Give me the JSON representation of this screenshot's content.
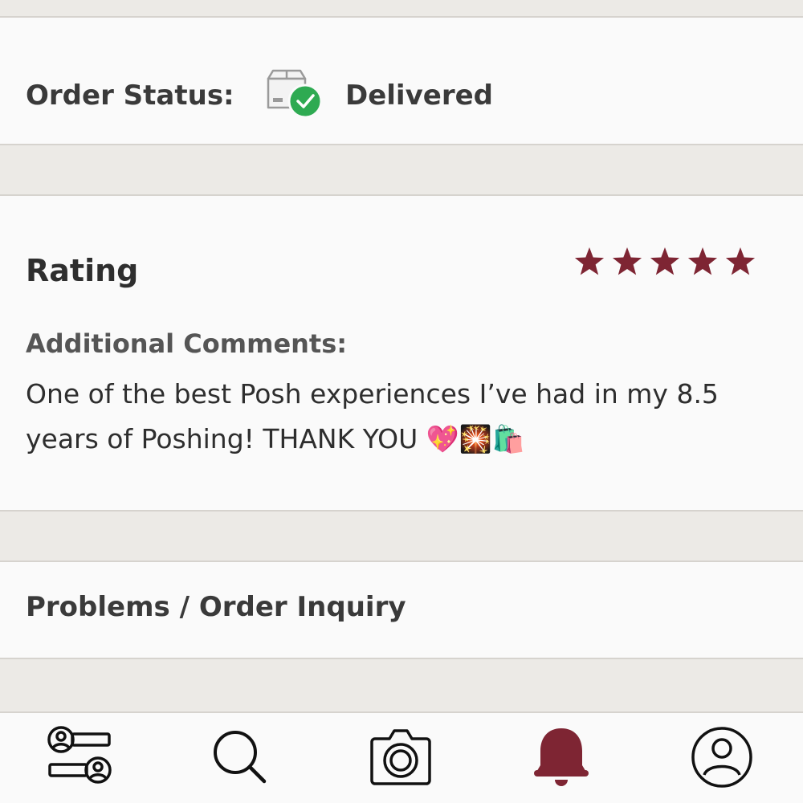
{
  "order_status": {
    "label": "Order Status:",
    "value": "Delivered",
    "icon": "package-delivered-icon"
  },
  "rating": {
    "title": "Rating",
    "stars": 5,
    "max_stars": 5,
    "star_color": "#7E2533",
    "comments_label": "Additional Comments:",
    "comments_text": "One of the best Posh experiences I’ve had in my 8.5 years of Poshing! THANK YOU 💖🎇🛍️"
  },
  "problems": {
    "label": "Problems / Order Inquiry"
  },
  "bottom_nav": {
    "items": [
      {
        "icon": "feed-users-icon"
      },
      {
        "icon": "search-icon"
      },
      {
        "icon": "camera-icon"
      },
      {
        "icon": "bell-icon",
        "active": true
      },
      {
        "icon": "profile-icon"
      }
    ],
    "active_color": "#7E2533"
  },
  "colors": {
    "accent": "#7E2533",
    "delivered_check": "#2EAA52",
    "background": "#ECEAE6",
    "panel": "#FAFAFA"
  }
}
